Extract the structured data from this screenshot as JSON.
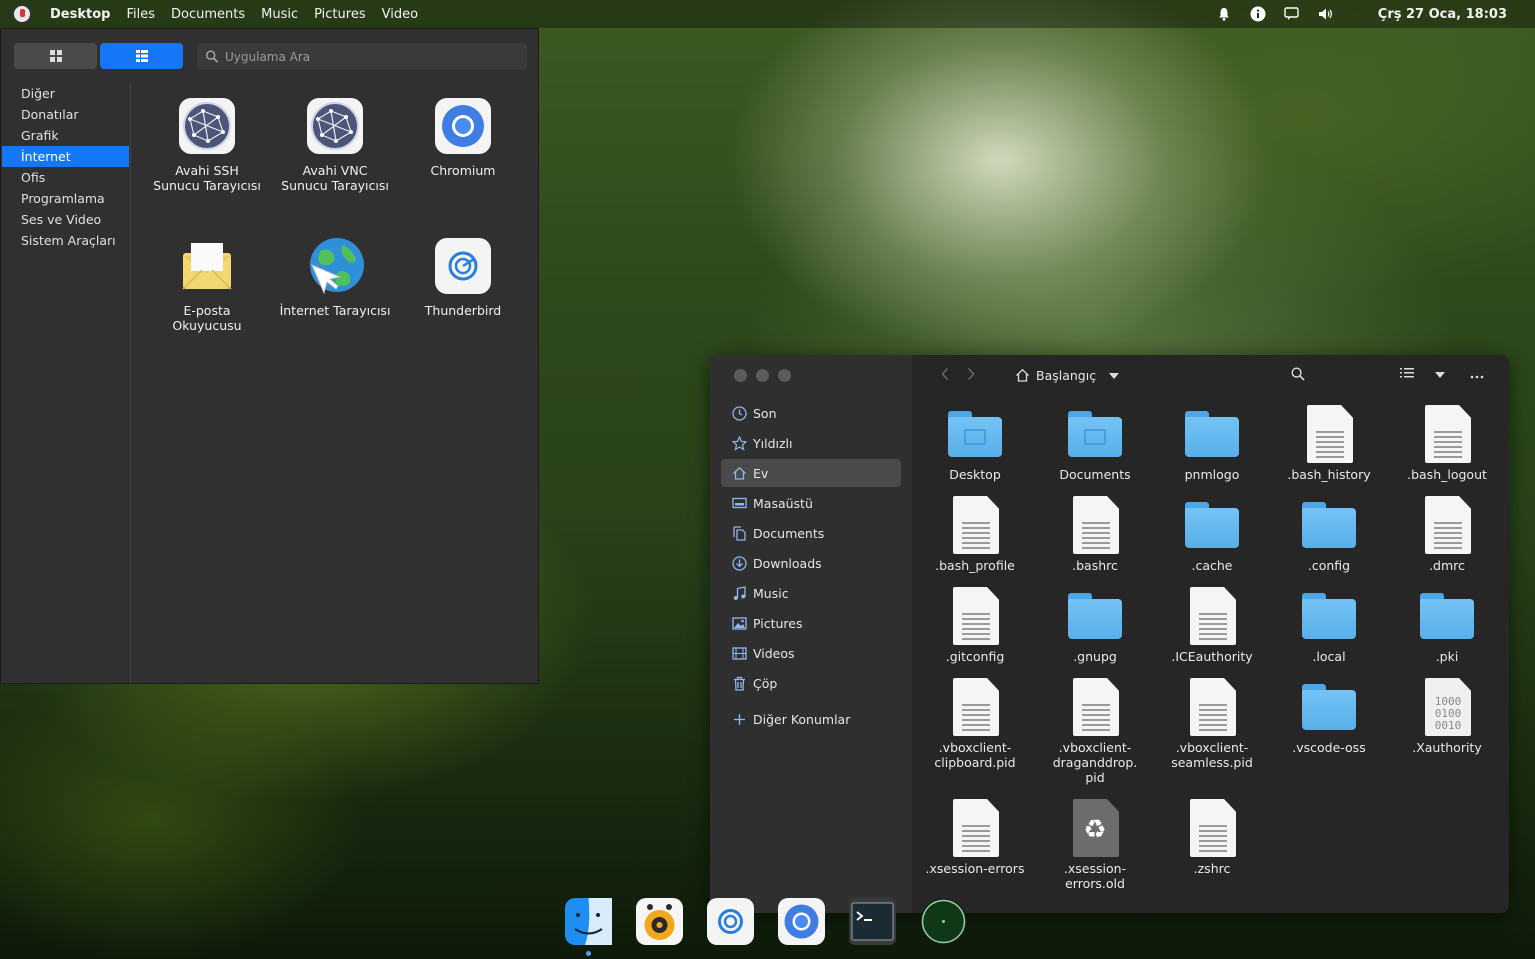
{
  "top_panel": {
    "menu": [
      "Desktop",
      "Files",
      "Documents",
      "Music",
      "Pictures",
      "Video"
    ],
    "clock": "Çrş 27 Oca, 18:03",
    "tray_icons": [
      "bell-icon",
      "info-icon",
      "chat-icon",
      "volume-icon"
    ]
  },
  "app_menu": {
    "search_placeholder": "Uygulama Ara",
    "categories": [
      "Diğer",
      "Donatılar",
      "Grafik",
      "İnternet",
      "Ofis",
      "Programlama",
      "Ses ve Video",
      "Sistem Araçları"
    ],
    "selected_category": "İnternet",
    "apps": [
      {
        "label": "Avahi SSH\nSunucu Tarayıcısı",
        "icon": "network-globe-icon"
      },
      {
        "label": "Avahi VNC\nSunucu Tarayıcısı",
        "icon": "network-globe-icon"
      },
      {
        "label": "Chromium",
        "icon": "chromium-icon"
      },
      {
        "label": "E-posta\nOkuyucusu",
        "icon": "mail-envelope-icon"
      },
      {
        "label": "İnternet Tarayıcısı",
        "icon": "web-browser-icon"
      },
      {
        "label": "Thunderbird",
        "icon": "thunderbird-icon"
      }
    ]
  },
  "file_manager": {
    "breadcrumb": "Başlangıç",
    "places": [
      {
        "label": "Son",
        "icon": "clock-icon"
      },
      {
        "label": "Yıldızlı",
        "icon": "star-icon"
      },
      {
        "label": "Ev",
        "icon": "home-icon"
      },
      {
        "label": "Masaüstü",
        "icon": "desktop-icon"
      },
      {
        "label": "Documents",
        "icon": "document-icon"
      },
      {
        "label": "Downloads",
        "icon": "download-icon"
      },
      {
        "label": "Music",
        "icon": "music-icon"
      },
      {
        "label": "Pictures",
        "icon": "picture-icon"
      },
      {
        "label": "Videos",
        "icon": "video-icon"
      },
      {
        "label": "Çöp",
        "icon": "trash-icon"
      }
    ],
    "active_place": "Ev",
    "other_locations": "Diğer Konumlar",
    "files": [
      {
        "name": "Desktop",
        "type": "folder"
      },
      {
        "name": "Documents",
        "type": "folder"
      },
      {
        "name": "pnmlogo",
        "type": "folder"
      },
      {
        "name": ".bash_history",
        "type": "text"
      },
      {
        "name": ".bash_logout",
        "type": "text"
      },
      {
        "name": ".bash_profile",
        "type": "text"
      },
      {
        "name": ".bashrc",
        "type": "text"
      },
      {
        "name": ".cache",
        "type": "folder"
      },
      {
        "name": ".config",
        "type": "folder"
      },
      {
        "name": ".dmrc",
        "type": "text"
      },
      {
        "name": ".gitconfig",
        "type": "text"
      },
      {
        "name": ".gnupg",
        "type": "folder"
      },
      {
        "name": ".ICEauthority",
        "type": "text"
      },
      {
        "name": ".local",
        "type": "folder"
      },
      {
        "name": ".pki",
        "type": "folder"
      },
      {
        "name": ".vboxclient-\nclipboard.pid",
        "type": "text"
      },
      {
        "name": ".vboxclient-\ndraganddrop.\npid",
        "type": "text"
      },
      {
        "name": ".vboxclient-\nseamless.pid",
        "type": "text"
      },
      {
        "name": ".vscode-oss",
        "type": "folder"
      },
      {
        "name": ".Xauthority",
        "type": "binary"
      },
      {
        "name": ".xsession-errors",
        "type": "text"
      },
      {
        "name": ".xsession-\nerrors.old",
        "type": "trash-doc"
      },
      {
        "name": ".zshrc",
        "type": "text"
      }
    ],
    "binary_icon_text": "1000\n0100\n0010"
  },
  "dock": {
    "items": [
      "finder-icon",
      "music-player-icon",
      "thunderbird-icon",
      "chromium-icon",
      "terminal-icon",
      "radar-icon"
    ]
  },
  "colors": {
    "accent": "#1477f8",
    "folder": "#74c3f5",
    "panel_bg": "#303030"
  }
}
